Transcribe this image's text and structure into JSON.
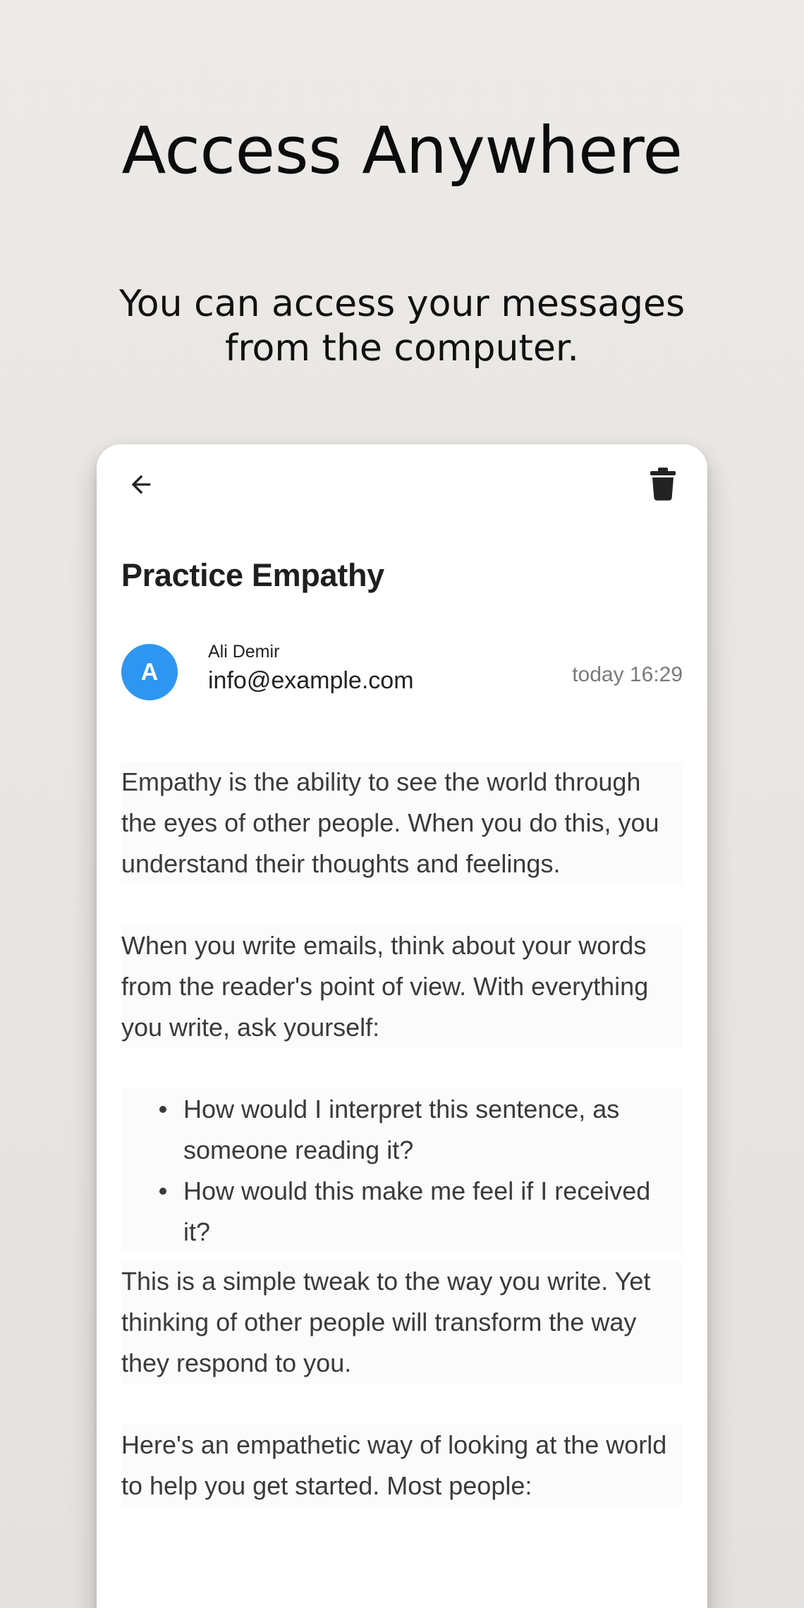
{
  "intro": {
    "title": "Access Anywhere",
    "subtitle_line1": "You can access your messages",
    "subtitle_line2": "from the computer."
  },
  "email": {
    "subject": "Practice Empathy",
    "avatar_initial": "A",
    "sender_name": "Ali Demir",
    "sender_email": "info@example.com",
    "timestamp": "today 16:29",
    "paragraphs": [
      "Empathy is the ability to see the world through the eyes of other people. When you do this, you understand their thoughts and feelings.",
      "When you write emails, think about your words from the reader's point of view. With everything you write, ask yourself:",
      "This is a simple tweak to the way you write. Yet thinking of other people will transform the way they respond to you.",
      "Here's an empathetic way of looking at the world to help you get started. Most people:"
    ],
    "bullets": [
      "How would I interpret this sentence, as someone reading it?",
      "How would this make me feel if I received it?"
    ]
  },
  "icons": {
    "back": "arrow-left-icon",
    "delete": "trash-icon"
  },
  "colors": {
    "avatar": "#2E96F0",
    "background": "#E9E6E3"
  }
}
